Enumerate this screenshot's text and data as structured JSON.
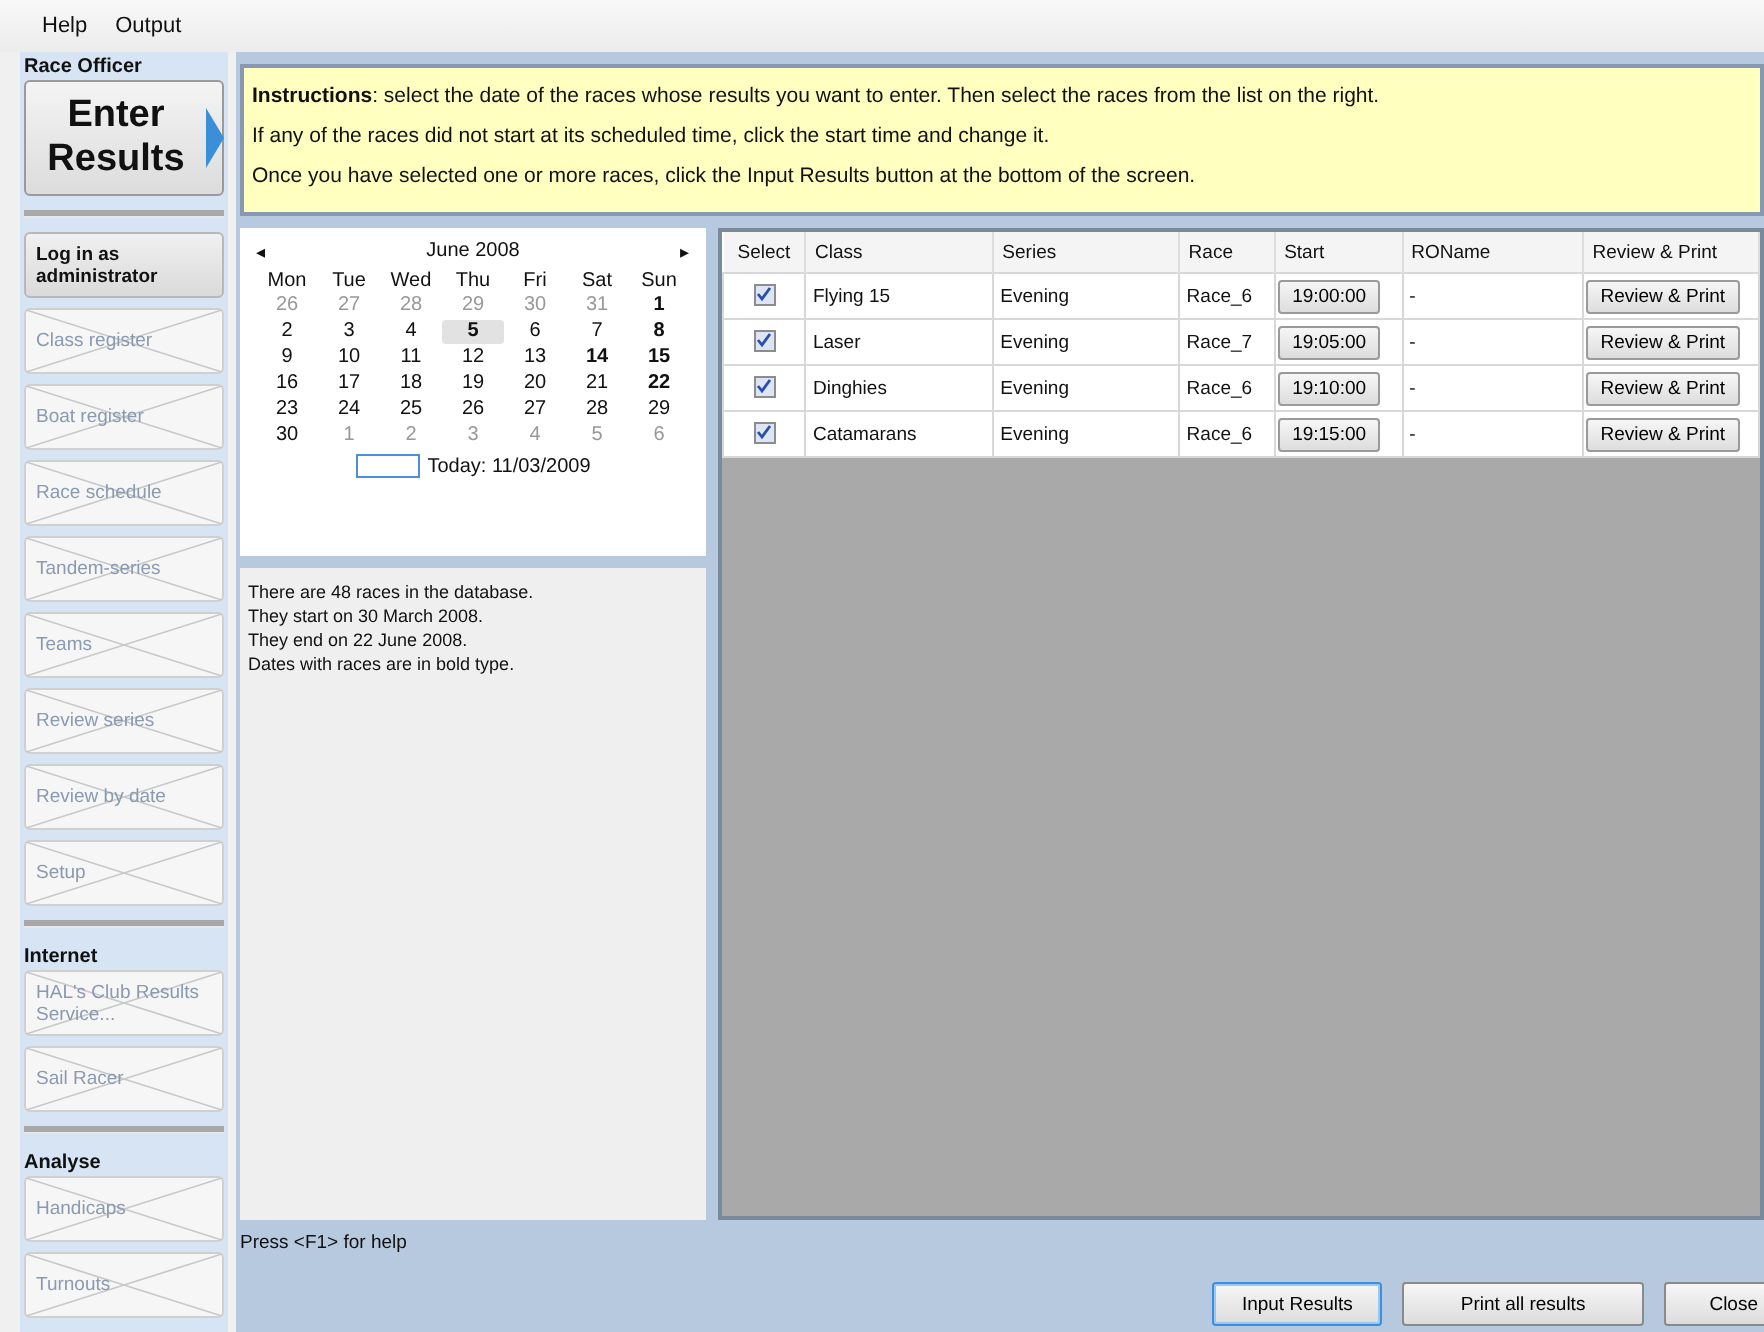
{
  "menu": [
    "Help",
    "Output"
  ],
  "sidebar": [
    {
      "kind": "heading",
      "label": "Race Officer"
    },
    {
      "kind": "big",
      "label": "Enter Results",
      "selected": true
    },
    {
      "kind": "rule"
    },
    {
      "kind": "button",
      "label": "Log in as administrator",
      "disabled": false
    },
    {
      "kind": "button",
      "label": "Class register",
      "disabled": true
    },
    {
      "kind": "button",
      "label": "Boat register",
      "disabled": true
    },
    {
      "kind": "button",
      "label": "Race schedule",
      "disabled": true
    },
    {
      "kind": "button",
      "label": "Tandem-series",
      "disabled": true
    },
    {
      "kind": "button",
      "label": "Teams",
      "disabled": true
    },
    {
      "kind": "button",
      "label": "Review series",
      "disabled": true
    },
    {
      "kind": "button",
      "label": "Review by date",
      "disabled": true
    },
    {
      "kind": "button",
      "label": "Setup",
      "disabled": true
    },
    {
      "kind": "rule"
    },
    {
      "kind": "heading",
      "label": "Internet"
    },
    {
      "kind": "button",
      "label": "HAL's Club Results Service...",
      "disabled": true
    },
    {
      "kind": "button",
      "label": "Sail Racer",
      "disabled": true
    },
    {
      "kind": "rule"
    },
    {
      "kind": "heading",
      "label": "Analyse"
    },
    {
      "kind": "button",
      "label": "Handicaps",
      "disabled": true
    },
    {
      "kind": "button",
      "label": "Turnouts",
      "disabled": true
    }
  ],
  "instructions": [
    "**Instructions**: select the date of the races whose results you want to enter.  Then select the races from the list on the right.",
    "If any of the races did not start at its scheduled time, click the start time and change it.",
    "Once you have selected one or more races, click the Input Results button at the bottom of the screen."
  ],
  "calendar": {
    "prev": "◂",
    "month": "June 2008",
    "next": "▸",
    "weekdays": [
      "Mon",
      "Tue",
      "Wed",
      "Thu",
      "Fri",
      "Sat",
      "Sun"
    ],
    "weeks": [
      [
        {
          "day": "26",
          "muted": true,
          "bold": false,
          "selected": false
        },
        {
          "day": "27",
          "muted": true,
          "bold": false,
          "selected": false
        },
        {
          "day": "28",
          "muted": true,
          "bold": false,
          "selected": false
        },
        {
          "day": "29",
          "muted": true,
          "bold": false,
          "selected": false
        },
        {
          "day": "30",
          "muted": true,
          "bold": false,
          "selected": false
        },
        {
          "day": "31",
          "muted": true,
          "bold": false,
          "selected": false
        },
        {
          "day": "1",
          "muted": false,
          "bold": true,
          "selected": false
        }
      ],
      [
        {
          "day": "2",
          "muted": false,
          "bold": false,
          "selected": false
        },
        {
          "day": "3",
          "muted": false,
          "bold": false,
          "selected": false
        },
        {
          "day": "4",
          "muted": false,
          "bold": false,
          "selected": false
        },
        {
          "day": "5",
          "muted": false,
          "bold": true,
          "selected": true
        },
        {
          "day": "6",
          "muted": false,
          "bold": false,
          "selected": false
        },
        {
          "day": "7",
          "muted": false,
          "bold": false,
          "selected": false
        },
        {
          "day": "8",
          "muted": false,
          "bold": true,
          "selected": false
        }
      ],
      [
        {
          "day": "9",
          "muted": false,
          "bold": false,
          "selected": false
        },
        {
          "day": "10",
          "muted": false,
          "bold": false,
          "selected": false
        },
        {
          "day": "11",
          "muted": false,
          "bold": false,
          "selected": false
        },
        {
          "day": "12",
          "muted": false,
          "bold": false,
          "selected": false
        },
        {
          "day": "13",
          "muted": false,
          "bold": false,
          "selected": false
        },
        {
          "day": "14",
          "muted": false,
          "bold": true,
          "selected": false
        },
        {
          "day": "15",
          "muted": false,
          "bold": true,
          "selected": false
        }
      ],
      [
        {
          "day": "16",
          "muted": false,
          "bold": false,
          "selected": false
        },
        {
          "day": "17",
          "muted": false,
          "bold": false,
          "selected": false
        },
        {
          "day": "18",
          "muted": false,
          "bold": false,
          "selected": false
        },
        {
          "day": "19",
          "muted": false,
          "bold": false,
          "selected": false
        },
        {
          "day": "20",
          "muted": false,
          "bold": false,
          "selected": false
        },
        {
          "day": "21",
          "muted": false,
          "bold": false,
          "selected": false
        },
        {
          "day": "22",
          "muted": false,
          "bold": true,
          "selected": false
        }
      ],
      [
        {
          "day": "23",
          "muted": false,
          "bold": false,
          "selected": false
        },
        {
          "day": "24",
          "muted": false,
          "bold": false,
          "selected": false
        },
        {
          "day": "25",
          "muted": false,
          "bold": false,
          "selected": false
        },
        {
          "day": "26",
          "muted": false,
          "bold": false,
          "selected": false
        },
        {
          "day": "27",
          "muted": false,
          "bold": false,
          "selected": false
        },
        {
          "day": "28",
          "muted": false,
          "bold": false,
          "selected": false
        },
        {
          "day": "29",
          "muted": false,
          "bold": false,
          "selected": false
        }
      ],
      [
        {
          "day": "30",
          "muted": false,
          "bold": false,
          "selected": false
        },
        {
          "day": "1",
          "muted": true,
          "bold": false,
          "selected": false
        },
        {
          "day": "2",
          "muted": true,
          "bold": false,
          "selected": false
        },
        {
          "day": "3",
          "muted": true,
          "bold": false,
          "selected": false
        },
        {
          "day": "4",
          "muted": true,
          "bold": false,
          "selected": false
        },
        {
          "day": "5",
          "muted": true,
          "bold": false,
          "selected": false
        },
        {
          "day": "6",
          "muted": true,
          "bold": false,
          "selected": false
        }
      ]
    ],
    "today": "Today: 11/03/2009"
  },
  "info": [
    "There are 48 races in the database.",
    "They start on 30 March 2008.",
    "They end on 22 June 2008.",
    "Dates with races are in bold type."
  ],
  "table": {
    "columns": [
      "Select",
      "Class",
      "Series",
      "Race",
      "Start",
      "ROName",
      "Review & Print"
    ],
    "rows": [
      {
        "checked": true,
        "class": "Flying 15",
        "series": "Evening",
        "race": "Race_6",
        "start": "19:00:00",
        "roname": "-",
        "action": "Review & Print"
      },
      {
        "checked": true,
        "class": "Laser",
        "series": "Evening",
        "race": "Race_7",
        "start": "19:05:00",
        "roname": "-",
        "action": "Review & Print"
      },
      {
        "checked": true,
        "class": "Dinghies",
        "series": "Evening",
        "race": "Race_6",
        "start": "19:10:00",
        "roname": "-",
        "action": "Review & Print"
      },
      {
        "checked": true,
        "class": "Catamarans",
        "series": "Evening",
        "race": "Race_6",
        "start": "19:15:00",
        "roname": "-",
        "action": "Review & Print"
      }
    ]
  },
  "status": "Press <F1> for help",
  "buttons": [
    {
      "label": "Input Results",
      "selected": true
    },
    {
      "label": "Print all results",
      "selected": false
    },
    {
      "label": "Close",
      "selected": false
    }
  ]
}
